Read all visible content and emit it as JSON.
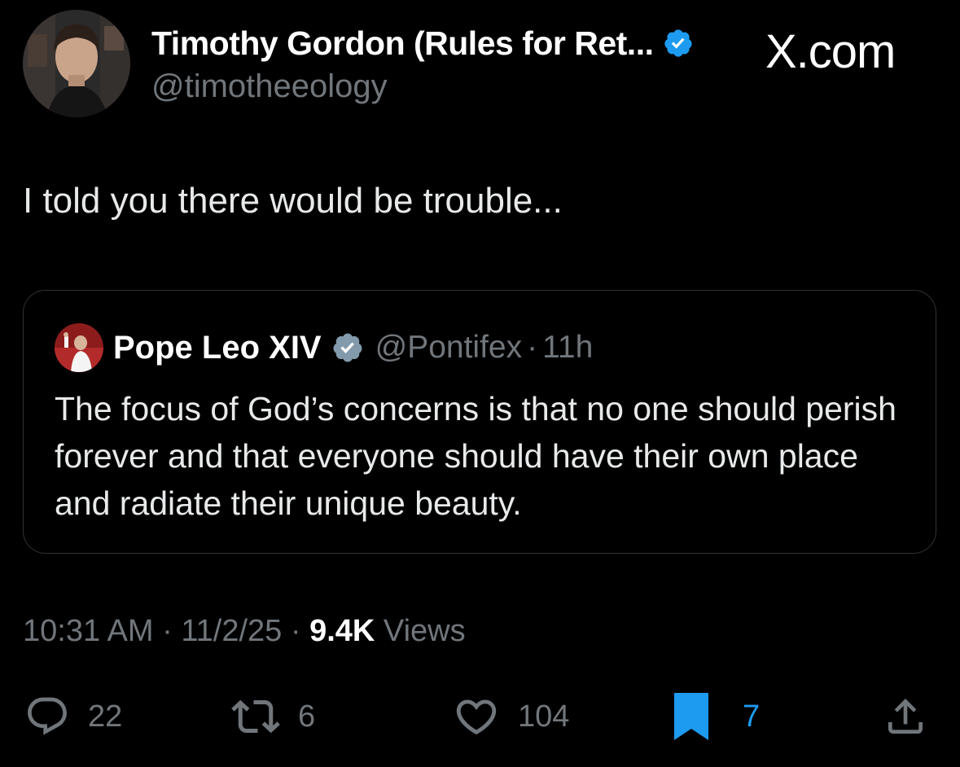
{
  "author": {
    "name": "Timothy Gordon (Rules for Ret...",
    "handle": "@timotheeology",
    "verified": true
  },
  "brand": "X.com",
  "tweet": {
    "text": "I told you there would be trouble..."
  },
  "quote": {
    "name": "Pope Leo XIV",
    "handle": "@Pontifex",
    "separator": "·",
    "time": "11h",
    "verified": true,
    "text": "The focus of God’s concerns is that no one should perish forever and that everyone should have their own place and radiate their unique beauty."
  },
  "meta": {
    "time": "10:31 AM",
    "separator1": " · ",
    "date": "11/2/25",
    "separator2": " · ",
    "views_count": "9.4K",
    "views_label": " Views"
  },
  "actions": {
    "replies": "22",
    "reposts": "6",
    "likes": "104",
    "bookmarks": "7"
  },
  "colors": {
    "background": "#000000",
    "accent": "#1d9bf0",
    "muted": "#71767b",
    "text": "#e7e9ea",
    "border": "#2f3336"
  },
  "icons": {
    "reply": "speech-bubble-icon",
    "repost": "repost-arrows-icon",
    "like": "heart-icon",
    "bookmark": "bookmark-icon",
    "share": "share-icon",
    "verified": "verified-badge-icon"
  }
}
